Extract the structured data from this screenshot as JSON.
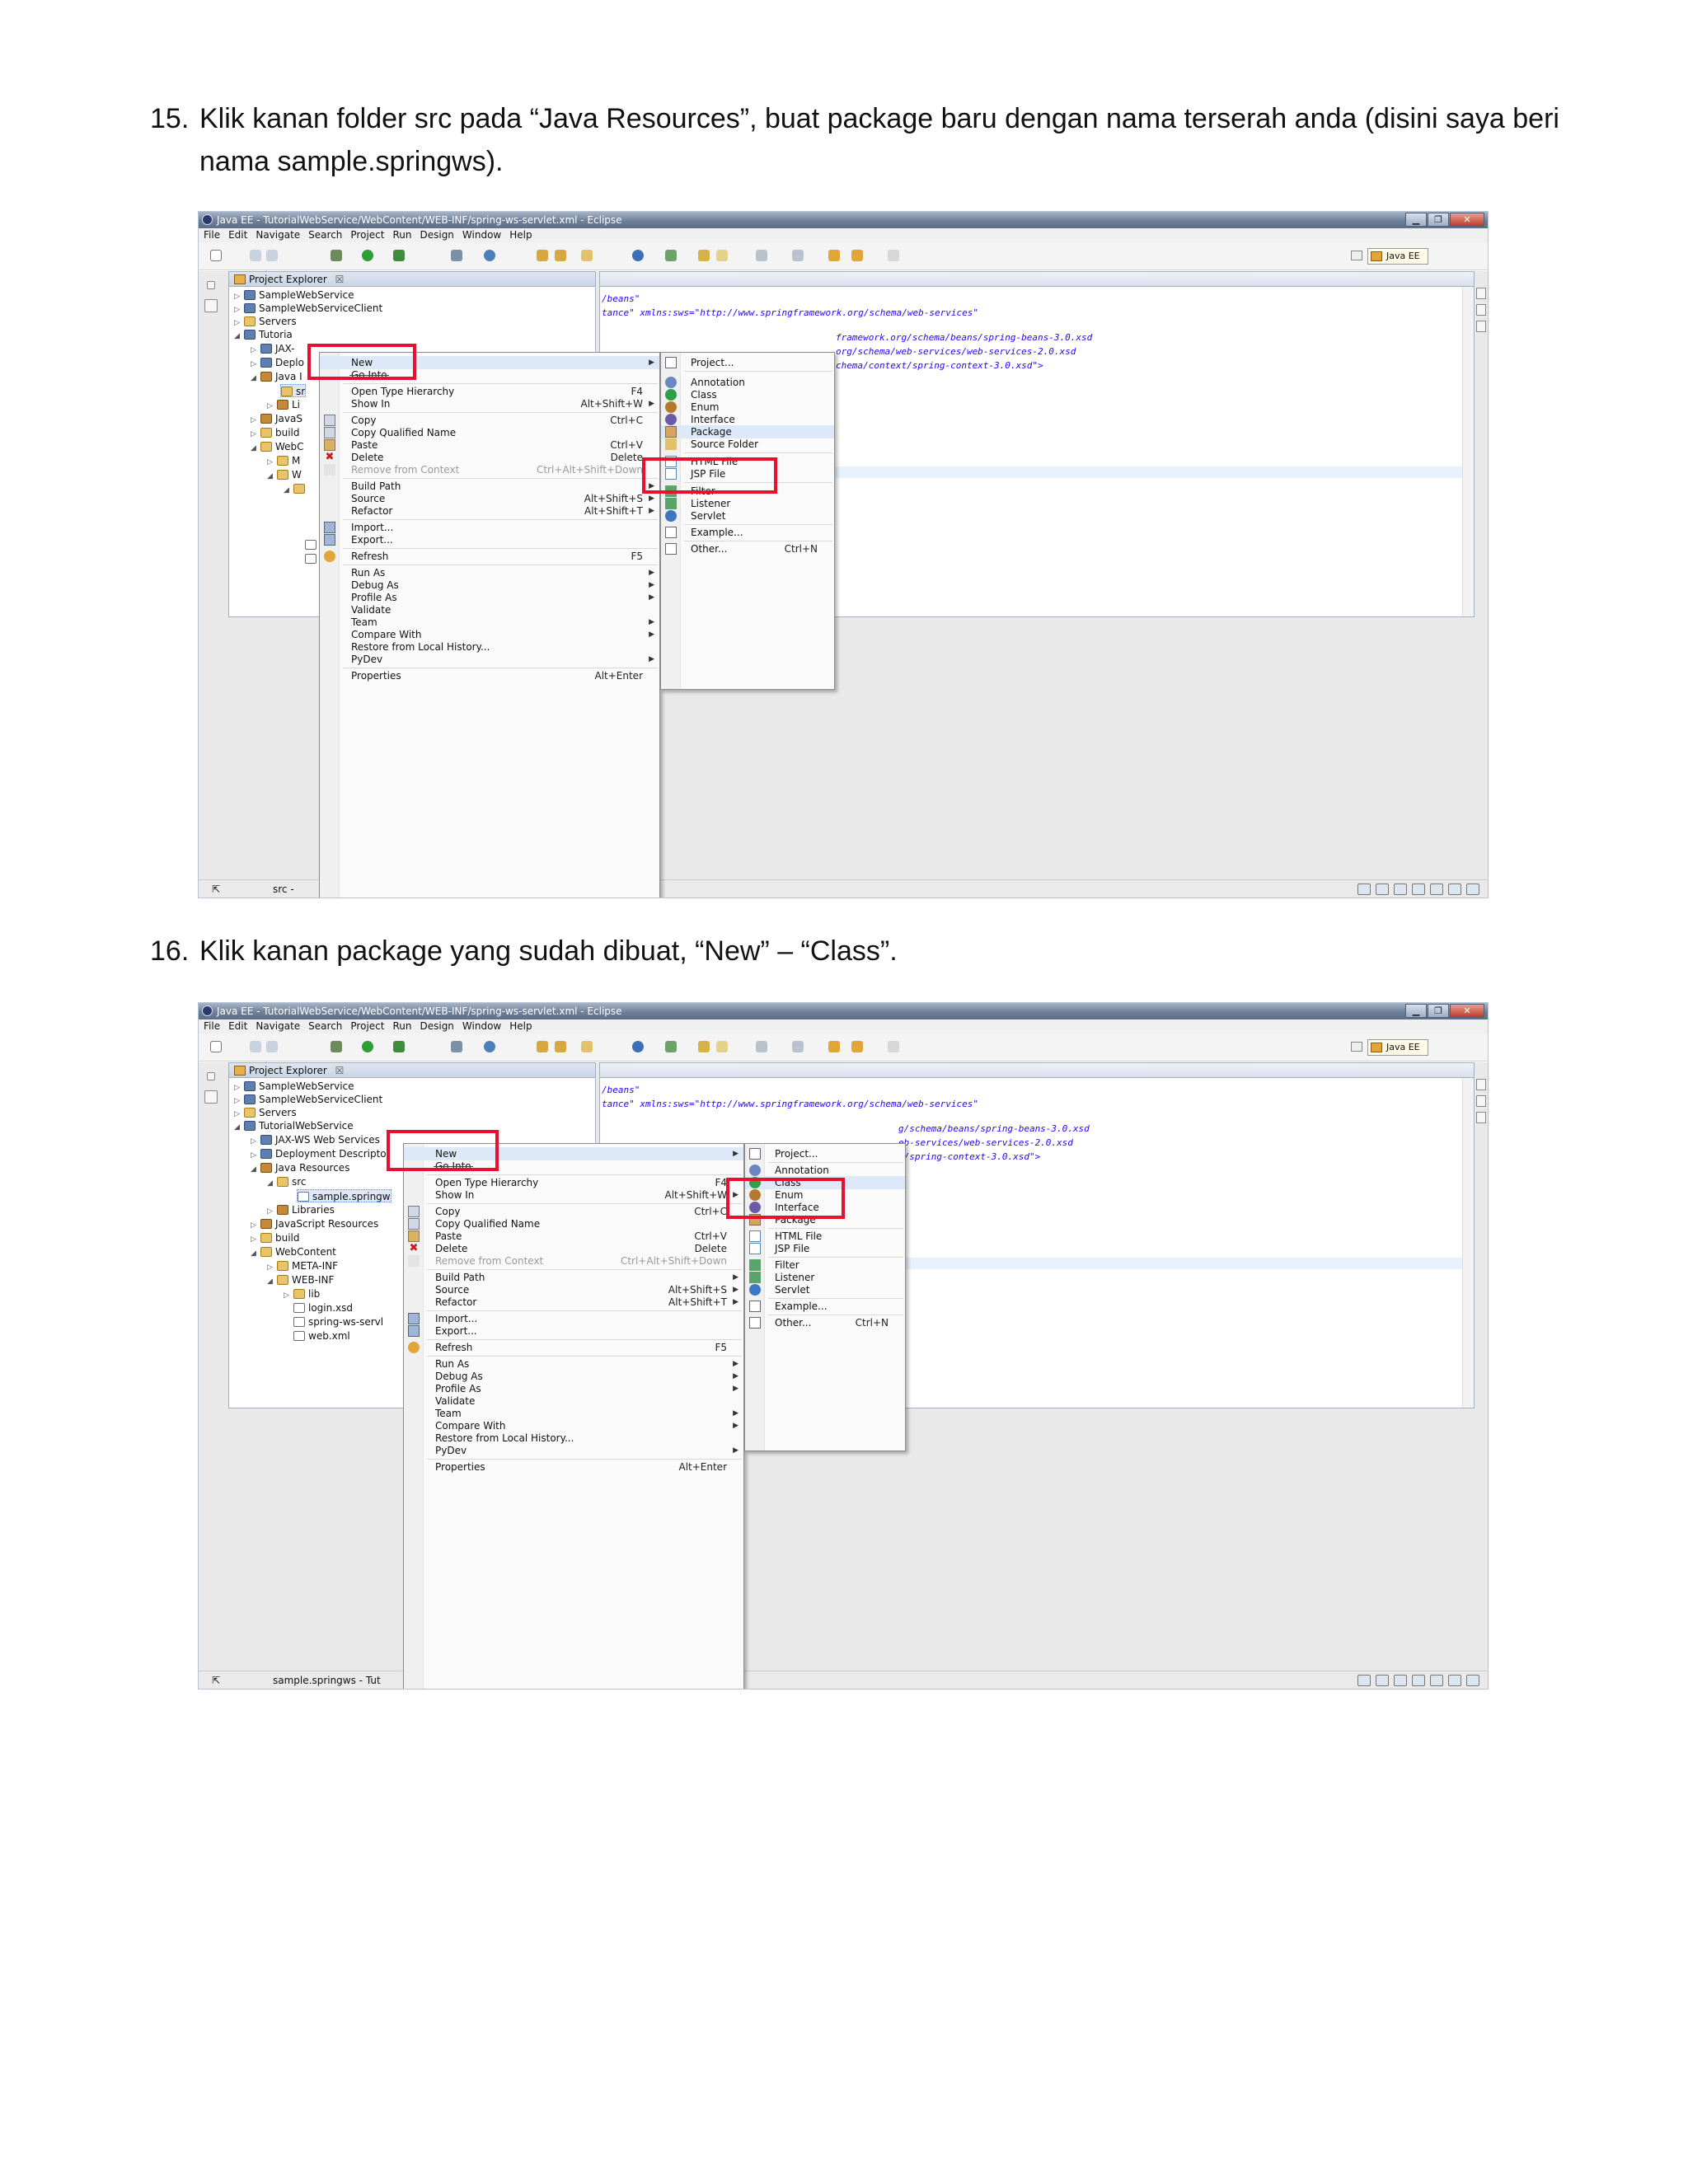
{
  "doc": {
    "step15": {
      "number": "15.",
      "text": "Klik kanan folder src pada “Java Resources”, buat package baru dengan nama terserah anda (disini saya beri nama sample.springws)."
    },
    "step16": {
      "number": "16.",
      "text": "Klik kanan package yang sudah dibuat, “New” – “Class”."
    }
  },
  "window": {
    "title": "Java EE - TutorialWebService/WebContent/WEB-INF/spring-ws-servlet.xml - Eclipse",
    "menu": [
      "File",
      "Edit",
      "Navigate",
      "Search",
      "Project",
      "Run",
      "Design",
      "Window",
      "Help"
    ],
    "perspective": "Java EE",
    "view_title": "Project Explorer",
    "view_close": "☒"
  },
  "shot1": {
    "tree": [
      "SampleWebService",
      "SampleWebServiceClient",
      "Servers",
      "Tutoria",
      "JAX-",
      "Deplo",
      "Java I",
      "sr",
      "Li",
      "JavaS",
      "build",
      "WebC",
      "M",
      "W"
    ],
    "code": [
      "/beans\"",
      "tance\" xmlns:sws=\"http://www.springframework.org/schema/web-services\"",
      "framework.org/schema/beans/spring-beans-3.0.xsd",
      "org/schema/web-services/web-services-2.0.xsd",
      "chema/context/spring-context-3.0.xsd\">"
    ],
    "status": "src -",
    "context_menu": {
      "new": "New",
      "go_into": "Go Into",
      "open_type_hierarchy": "Open Type Hierarchy",
      "open_type_hierarchy_sc": "F4",
      "show_in": "Show In",
      "show_in_sc": "Alt+Shift+W",
      "copy": "Copy",
      "copy_sc": "Ctrl+C",
      "copy_qualified": "Copy Qualified Name",
      "paste": "Paste",
      "paste_sc": "Ctrl+V",
      "delete": "Delete",
      "delete_sc": "Delete",
      "remove_ctx": "Remove from Context",
      "remove_ctx_sc": "Ctrl+Alt+Shift+Down",
      "build_path": "Build Path",
      "source": "Source",
      "source_sc": "Alt+Shift+S",
      "refactor": "Refactor",
      "refactor_sc": "Alt+Shift+T",
      "import": "Import...",
      "export": "Export...",
      "refresh": "Refresh",
      "refresh_sc": "F5",
      "run_as": "Run As",
      "debug_as": "Debug As",
      "profile_as": "Profile As",
      "validate": "Validate",
      "team": "Team",
      "compare_with": "Compare With",
      "restore_history": "Restore from Local History...",
      "pydev": "PyDev",
      "properties": "Properties",
      "properties_sc": "Alt+Enter"
    },
    "submenu": {
      "project": "Project...",
      "annotation": "Annotation",
      "class": "Class",
      "enum": "Enum",
      "interface": "Interface",
      "package": "Package",
      "source_folder": "Source Folder",
      "html_file": "HTML File",
      "jsp_file": "JSP File",
      "filter": "Filter",
      "listener": "Listener",
      "servlet": "Servlet",
      "example": "Example...",
      "other": "Other...",
      "other_sc": "Ctrl+N"
    }
  },
  "shot2": {
    "tree": [
      "SampleWebService",
      "SampleWebServiceClient",
      "Servers",
      "TutorialWebService",
      "JAX-WS Web Services",
      "Deployment Descripto",
      "Java Resources",
      "src",
      "sample.springw",
      "Libraries",
      "JavaScript Resources",
      "build",
      "WebContent",
      "META-INF",
      "WEB-INF",
      "lib",
      "login.xsd",
      "spring-ws-servl",
      "web.xml"
    ],
    "code": [
      "/beans\"",
      "tance\" xmlns:sws=\"http://www.springframework.org/schema/web-services\"",
      "g/schema/beans/spring-beans-3.0.xsd",
      "eb-services/web-services-2.0.xsd",
      "t/spring-context-3.0.xsd\">"
    ],
    "status": "sample.springws - Tut"
  },
  "colors": {
    "highlight_box": "#e8102e",
    "code_text": "#2a00ff"
  }
}
